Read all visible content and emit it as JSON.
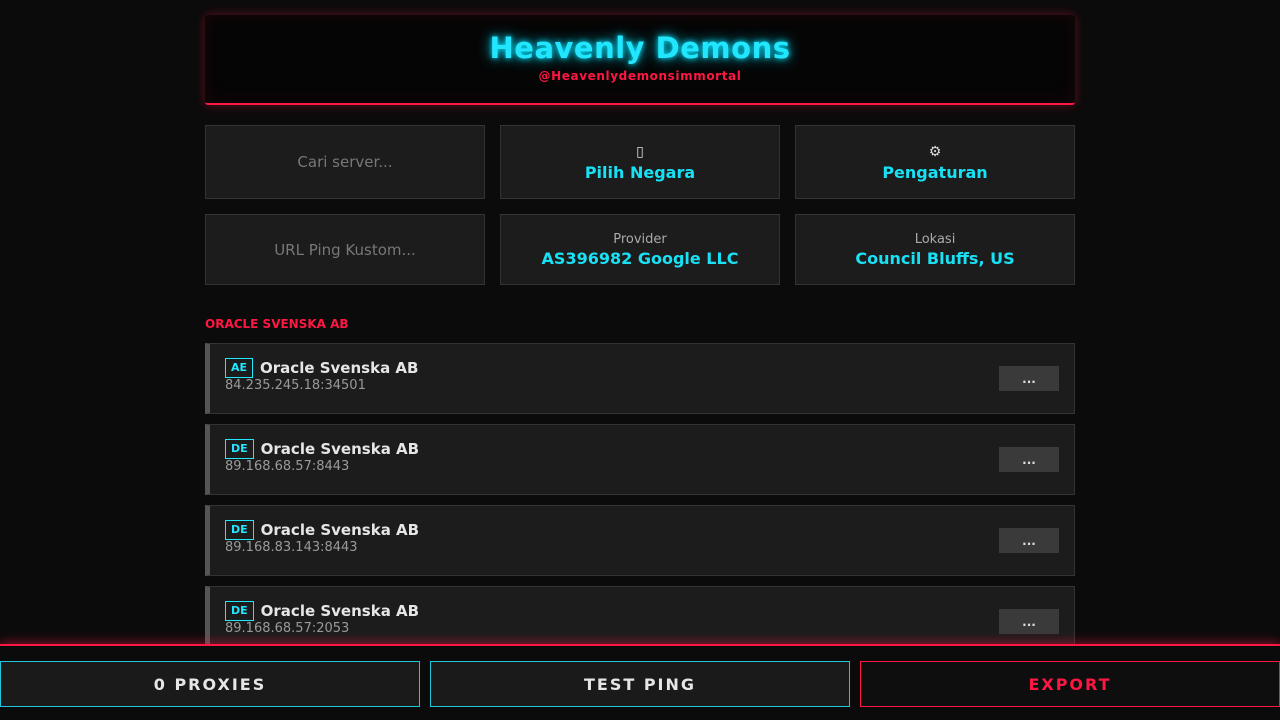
{
  "header": {
    "title": "Heavenly Demons",
    "subtitle": "@Heavenlydemonsimmortal"
  },
  "controls": {
    "search_placeholder": "Cari server...",
    "country": {
      "icon": "flag-icon",
      "icon_glyph": "▯",
      "label": "Pilih Negara"
    },
    "settings": {
      "icon": "gear-icon",
      "icon_glyph": "⚙",
      "label": "Pengaturan"
    },
    "ping_url_placeholder": "URL Ping Kustom...",
    "provider": {
      "label": "Provider",
      "value": "AS396982 Google LLC"
    },
    "location": {
      "label": "Lokasi",
      "value": "Council Bluffs, US"
    }
  },
  "section": {
    "title": "ORACLE SVENSKA AB"
  },
  "servers": [
    {
      "country": "AE",
      "name": "Oracle Svenska AB",
      "address": "84.235.245.18:34501",
      "ping": "..."
    },
    {
      "country": "DE",
      "name": "Oracle Svenska AB",
      "address": "89.168.68.57:8443",
      "ping": "..."
    },
    {
      "country": "DE",
      "name": "Oracle Svenska AB",
      "address": "89.168.83.143:8443",
      "ping": "..."
    },
    {
      "country": "DE",
      "name": "Oracle Svenska AB",
      "address": "89.168.68.57:2053",
      "ping": "..."
    }
  ],
  "footer": {
    "proxies_label": "0 PROXIES",
    "test_ping_label": "TEST PING",
    "export_label": "EXPORT"
  },
  "colors": {
    "accent_cyan": "#22e6ff",
    "accent_red": "#ff1744",
    "background": "#0b0b0b",
    "panel": "#1c1c1c"
  }
}
